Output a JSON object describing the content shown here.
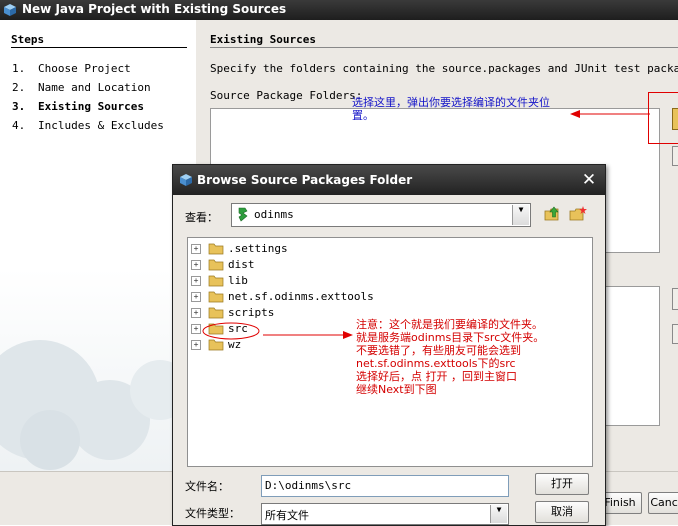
{
  "window": {
    "title": "New Java Project with Existing Sources"
  },
  "steps": {
    "heading": "Steps",
    "items": [
      {
        "num": "1.",
        "label": "Choose Project"
      },
      {
        "num": "2.",
        "label": "Name and Location"
      },
      {
        "num": "3.",
        "label": "Existing Sources"
      },
      {
        "num": "4.",
        "label": "Includes & Excludes"
      }
    ],
    "active_index": 2
  },
  "content": {
    "heading": "Existing Sources",
    "description": "Specify the folders containing the source.packages and JUnit test packages.",
    "source_label": "Source Package Folders:"
  },
  "buttons": {
    "finish": "Finish",
    "cancel": "Cancel"
  },
  "annotations": {
    "top_note": "选择这里，弹出你要选择编译的文件夹位置。",
    "src_note": [
      "注意：这个就是我们要编译的文件夹。",
      "就是服务端odinms目录下src文件夹。",
      "不要选错了，有些朋友可能会选到",
      "net.sf.odinms.exttools下的src",
      "选择好后，点 打开 ，回到主窗口",
      "继续Next到下图"
    ]
  },
  "dialog": {
    "title": "Browse Source Packages Folder",
    "look_in_label": "查看：",
    "look_in_value": "odinms",
    "tree": [
      ".settings",
      "dist",
      "lib",
      "net.sf.odinms.exttools",
      "scripts",
      "src",
      "wz"
    ],
    "file_name_label": "文件名：",
    "file_name_value": "D:\\odinms\\src",
    "file_type_label": "文件类型：",
    "file_type_value": "所有文件",
    "open_button": "打开",
    "cancel_button": "取消"
  },
  "colors": {
    "annotation_blue": "#1414c8",
    "annotation_red": "#d40000",
    "folder": "#e8c25a"
  }
}
